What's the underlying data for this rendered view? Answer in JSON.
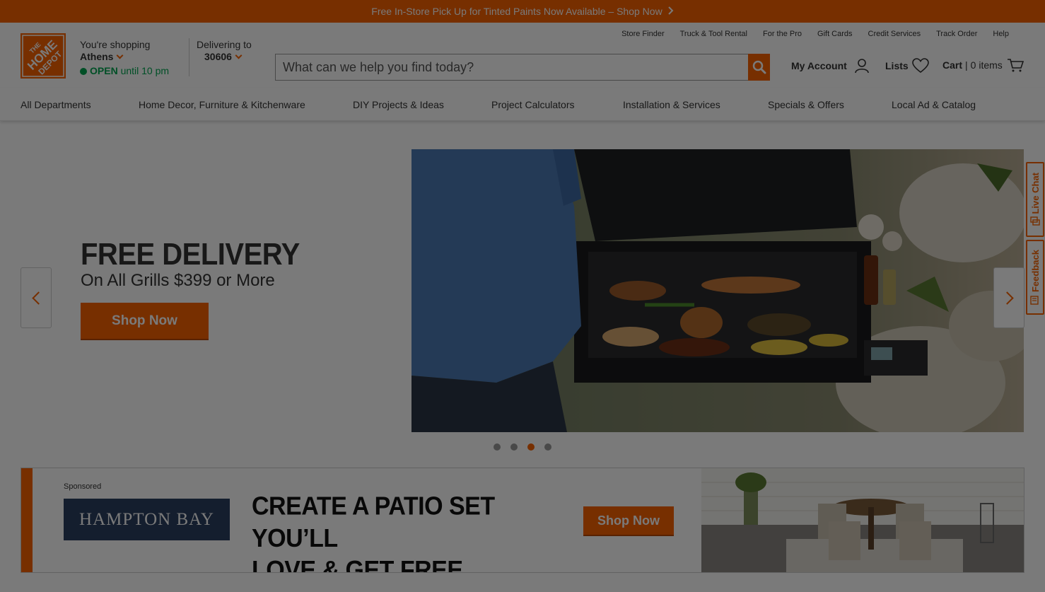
{
  "promo": {
    "text": "Free In-Store Pick Up for Tinted Paints Now Available – Shop Now",
    "chevron_icon": "chevron-right-icon"
  },
  "brand": {
    "logo_text_1": "THE",
    "logo_text_2": "HOME",
    "logo_text_3": "DEPOT",
    "accent": "#f96302"
  },
  "store": {
    "label": "You're shopping",
    "city": "Athens",
    "status": "OPEN",
    "hours": "until 10 pm"
  },
  "delivery": {
    "label": "Delivering to",
    "zip": "30606"
  },
  "top_links": [
    "Store Finder",
    "Truck & Tool Rental",
    "For the Pro",
    "Gift Cards",
    "Credit Services",
    "Track Order",
    "Help"
  ],
  "search": {
    "placeholder": "What can we help you find today?"
  },
  "account": {
    "my_account": "My Account",
    "lists": "Lists",
    "cart": "Cart",
    "cart_sep": "|",
    "cart_count": "0 items"
  },
  "nav": [
    "All Departments",
    "Home Decor, Furniture & Kitchenware",
    "DIY Projects & Ideas",
    "Project Calculators",
    "Installation & Services",
    "Specials & Offers",
    "Local Ad & Catalog"
  ],
  "hero": {
    "title": "FREE DELIVERY",
    "subtitle": "On All Grills $399 or More",
    "button": "Shop Now",
    "slides_total": 4,
    "active_slide": 3
  },
  "side_tabs": {
    "live_chat": "Live Chat",
    "feedback": "Feedback"
  },
  "banner": {
    "sponsored": "Sponsored",
    "brand_logo": "HAMPTON BAY",
    "headline_line1": "CREATE A PATIO SET YOU’LL",
    "headline_line2": "LOVE & GET FREE DELIVERY",
    "button": "Shop Now"
  }
}
